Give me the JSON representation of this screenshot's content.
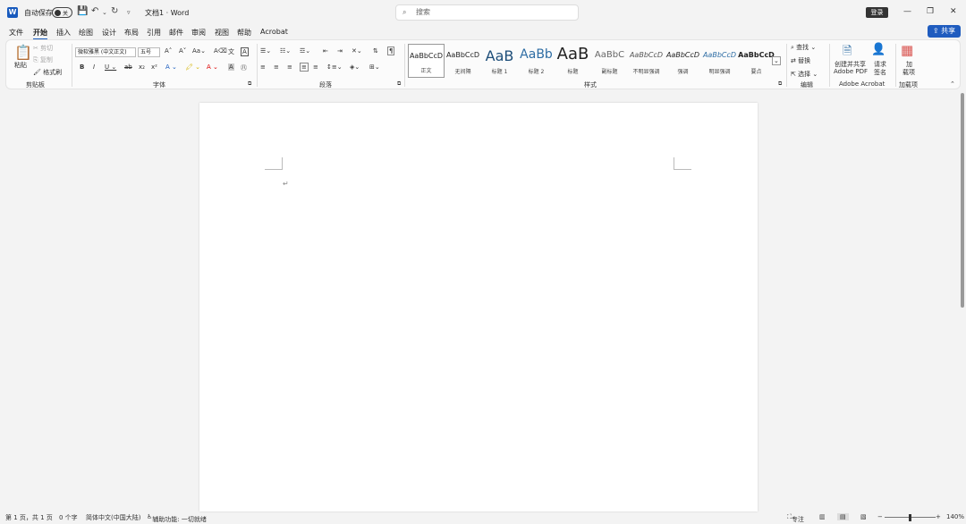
{
  "titlebar": {
    "app_letter": "W",
    "autosave_label": "自动保存",
    "autosave_state": "关",
    "doc_title": "文档1 · Word",
    "search_placeholder": "搜索",
    "login_label": "登录"
  },
  "menu": [
    "文件",
    "开始",
    "插入",
    "绘图",
    "设计",
    "布局",
    "引用",
    "邮件",
    "审阅",
    "视图",
    "帮助",
    "Acrobat"
  ],
  "share_label": "共享",
  "clipboard": {
    "paste": "粘贴",
    "cut": "剪切",
    "copy": "复制",
    "format_painter": "格式刷",
    "label": "剪贴板"
  },
  "font": {
    "name": "微软雅黑 (中文正文)",
    "size": "五号",
    "label": "字体"
  },
  "paragraph": {
    "label": "段落"
  },
  "styles": {
    "label": "样式",
    "items": [
      {
        "preview": "AaBbCcD",
        "name": "正文"
      },
      {
        "preview": "AaBbCcD",
        "name": "无间隔"
      },
      {
        "preview": "AaB",
        "name": "标题 1"
      },
      {
        "preview": "AaBb",
        "name": "标题 2"
      },
      {
        "preview": "AaB",
        "name": "标题"
      },
      {
        "preview": "AaBbC",
        "name": "副标题"
      },
      {
        "preview": "AaBbCcD",
        "name": "不明显强调"
      },
      {
        "preview": "AaBbCcD",
        "name": "强调"
      },
      {
        "preview": "AaBbCcD",
        "name": "明显强调"
      },
      {
        "preview": "AaBbCcD",
        "name": "要点"
      }
    ]
  },
  "editing": {
    "find": "查找",
    "replace": "替换",
    "select": "选择",
    "label": "编辑"
  },
  "acrobat": {
    "create": "创建并共享",
    "create2": "Adobe PDF",
    "request": "请求",
    "request2": "签名",
    "label": "Adobe Acrobat"
  },
  "addins": {
    "add": "加",
    "add2": "载项",
    "label": "加载项"
  },
  "status": {
    "page": "第 1 页，共 1 页",
    "words": "0 个字",
    "lang": "简体中文(中国大陆)",
    "access": "辅助功能: 一切就绪",
    "focus": "专注",
    "zoom": "140%"
  },
  "colors": {
    "accent": "#185abd",
    "share": "#1f5cbf"
  }
}
